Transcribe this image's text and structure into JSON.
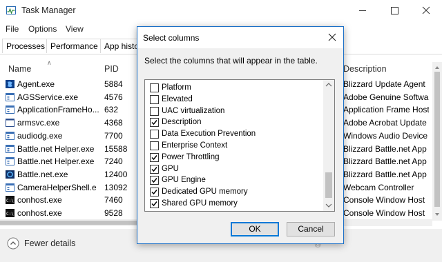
{
  "window": {
    "title": "Task Manager"
  },
  "menu": [
    "File",
    "Options",
    "View"
  ],
  "tabs": [
    "Processes",
    "Performance",
    "App histo"
  ],
  "columns": {
    "name": "Name",
    "pid": "PID",
    "description": "Description"
  },
  "rows": [
    {
      "name": "Agent.exe",
      "pid": "5884",
      "description": "Blizzard Update Agent",
      "icon": "blizzard-icon"
    },
    {
      "name": "AGSService.exe",
      "pid": "4576",
      "description": "Adobe Genuine Software",
      "icon": "app-window-icon"
    },
    {
      "name": "ApplicationFrameHo...",
      "pid": "632",
      "description": "Application Frame Host",
      "icon": "app-window-icon"
    },
    {
      "name": "armsvc.exe",
      "pid": "4368",
      "description": "Adobe Acrobat Update S",
      "icon": "service-icon"
    },
    {
      "name": "audiodg.exe",
      "pid": "7700",
      "description": "Windows Audio Device G",
      "icon": "app-window-icon"
    },
    {
      "name": "Battle.net Helper.exe",
      "pid": "15588",
      "description": "Blizzard Battle.net App B",
      "icon": "app-window-icon"
    },
    {
      "name": "Battle.net Helper.exe",
      "pid": "7240",
      "description": "Blizzard Battle.net App B",
      "icon": "app-window-icon"
    },
    {
      "name": "Battle.net.exe",
      "pid": "12400",
      "description": "Blizzard Battle.net App",
      "icon": "battlenet-icon"
    },
    {
      "name": "CameraHelperShell.e",
      "pid": "13092",
      "description": "Webcam Controller",
      "icon": "app-window-icon"
    },
    {
      "name": "conhost.exe",
      "pid": "7460",
      "description": "Console Window Host",
      "icon": "console-icon"
    },
    {
      "name": "conhost.exe",
      "pid": "9528",
      "description": "Console Window Host",
      "icon": "console-icon"
    }
  ],
  "footer": {
    "fewer_details": "Fewer details",
    "watermark": "@"
  },
  "dialog": {
    "title": "Select columns",
    "instruction": "Select the columns that will appear in the table.",
    "options": [
      {
        "label": "Platform",
        "checked": false
      },
      {
        "label": "Elevated",
        "checked": false
      },
      {
        "label": "UAC virtualization",
        "checked": false
      },
      {
        "label": "Description",
        "checked": true
      },
      {
        "label": "Data Execution Prevention",
        "checked": false
      },
      {
        "label": "Enterprise Context",
        "checked": false
      },
      {
        "label": "Power Throttling",
        "checked": true
      },
      {
        "label": "GPU",
        "checked": true
      },
      {
        "label": "GPU Engine",
        "checked": true
      },
      {
        "label": "Dedicated GPU memory",
        "checked": true
      },
      {
        "label": "Shared GPU memory",
        "checked": true
      }
    ],
    "ok": "OK",
    "cancel": "Cancel"
  },
  "colors": {
    "accent": "#0078d7",
    "dialog_border": "#1a6fc7"
  }
}
